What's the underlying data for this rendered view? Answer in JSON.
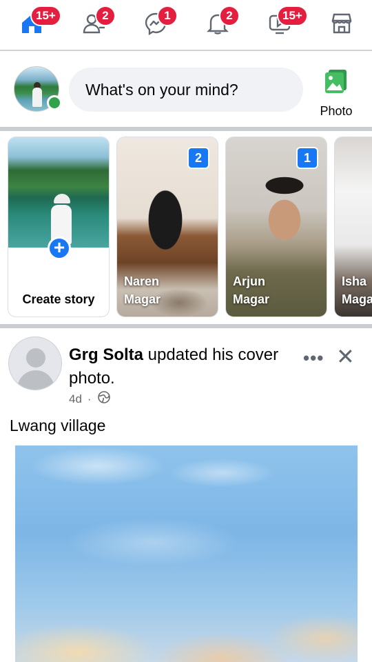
{
  "colors": {
    "brand": "#1877f2",
    "badge": "#e41e3f",
    "online": "#31a24c",
    "photo_icon": "#45bd62"
  },
  "topnav": {
    "items": [
      {
        "icon": "home-icon",
        "badge": "15+"
      },
      {
        "icon": "friends-icon",
        "badge": "2"
      },
      {
        "icon": "messenger-icon",
        "badge": "1"
      },
      {
        "icon": "bell-icon",
        "badge": "2"
      },
      {
        "icon": "video-icon",
        "badge": "15+"
      },
      {
        "icon": "marketplace-icon",
        "badge": ""
      }
    ]
  },
  "composer": {
    "placeholder": "What's on your mind?",
    "photo_label": "Photo"
  },
  "stories": {
    "create_label": "Create story",
    "items": [
      {
        "name_line1": "Naren",
        "name_line2": "Magar",
        "count": "2"
      },
      {
        "name_line1": "Arjun",
        "name_line2": "Magar",
        "count": "1"
      },
      {
        "name_line1": "Isha",
        "name_line2": "Maga",
        "count": ""
      }
    ]
  },
  "post": {
    "author": "Grg Solta",
    "action": " updated his cover photo.",
    "time": "4d",
    "separator": "·",
    "text": "Lwang village",
    "more_label": "•••",
    "close_label": "✕"
  }
}
